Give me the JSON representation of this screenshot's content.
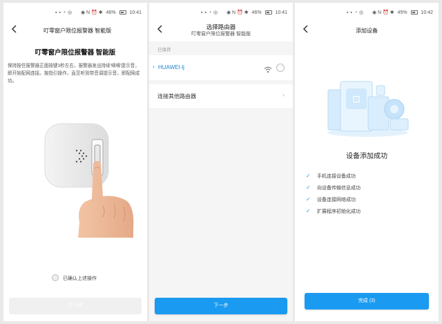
{
  "status_bars": [
    {
      "icons": "▪ ▪ ◔ ◎",
      "right_icons": "◉ N ⏰ ✱",
      "battery": "46%",
      "time": "10:41"
    },
    {
      "icons": "▪ ▪ ◔ ◎",
      "right_icons": "◉ N ⏰ ✱",
      "battery": "46%",
      "time": "10:41"
    },
    {
      "icons": "▪ ▪ ◔ ◎",
      "right_icons": "◉ N ⏰ ✱",
      "battery": "45%",
      "time": "10:42"
    }
  ],
  "screen1": {
    "header_title": "叮零窗户限位报警器 智能版",
    "title": "叮零窗户限位报警器 智能版",
    "description": "保持按住报警器正面按键3秒左右，报警器发出持续'嘀嘀'提示音，即开始配网连接。按指引操作，直至听到带音调提示音，即配网成功。",
    "confirm_label": "已确认上述操作",
    "next_button": "下一步"
  },
  "screen2": {
    "header_title": "选择路由器",
    "header_subtitle": "叮零窗户限位报警器 智能版",
    "saved_label": "已保存",
    "saved_network": "HUAWEI-lj",
    "other_router_label": "连接其他路由器",
    "next_button": "下一步"
  },
  "screen3": {
    "header_title": "添加设备",
    "success_title": "设备添加成功",
    "steps": [
      "手机连接设备成功",
      "向设备传输信息成功",
      "设备连接网络成功",
      "扩展程序初始化成功"
    ],
    "done_button": "完成 (3)"
  },
  "colors": {
    "accent": "#1a9af0",
    "link": "#1a86d8"
  },
  "icons": [
    "back-icon",
    "wifi-icon",
    "more-icon",
    "chevron-right-icon",
    "check-icon",
    "radio-icon"
  ]
}
